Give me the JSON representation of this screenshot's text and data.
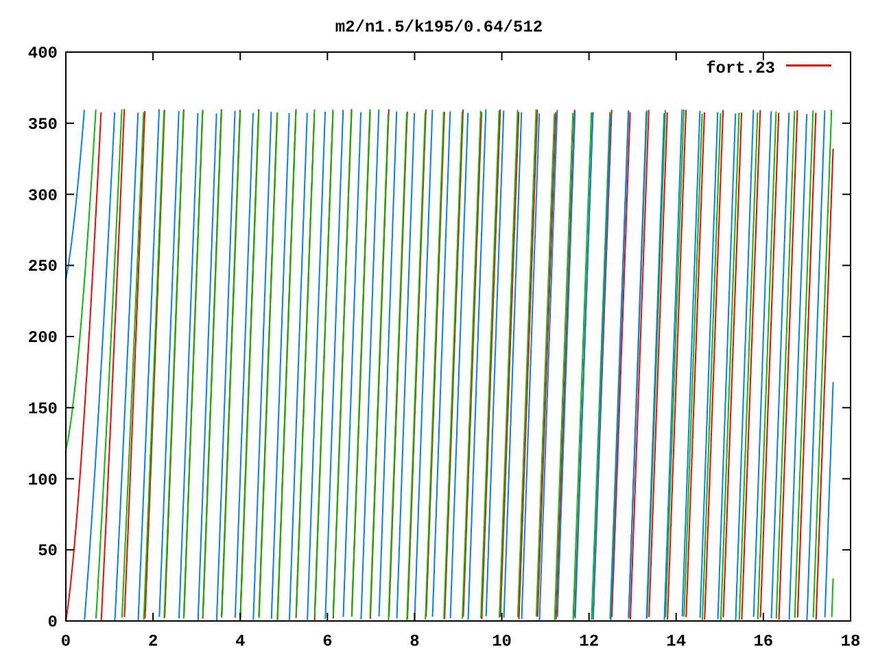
{
  "title": "m2/n1.5/k195/0.64/512",
  "y_axis": {
    "ticks": [
      "400",
      "350",
      "300",
      "250",
      "200",
      "150",
      "100",
      "50",
      "0"
    ]
  },
  "x_axis": {
    "ticks": [
      "0",
      "2",
      "4",
      "6",
      "8",
      "10",
      "12",
      "14",
      "16",
      "18"
    ]
  },
  "legend": [
    {
      "label": "fort.23",
      "color": "#ff0000"
    }
  ]
}
